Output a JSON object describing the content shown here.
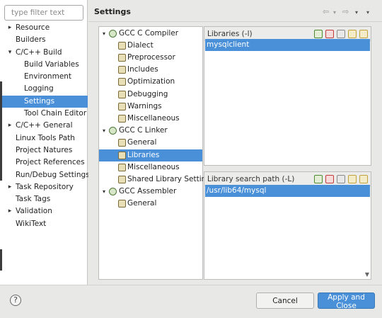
{
  "filter": {
    "placeholder": "type filter text"
  },
  "sidebar": {
    "items": [
      {
        "label": "Resource",
        "expandable": true,
        "indent": 0
      },
      {
        "label": "Builders",
        "expandable": false,
        "indent": 0
      },
      {
        "label": "C/C++ Build",
        "expandable": true,
        "expanded": true,
        "indent": 0
      },
      {
        "label": "Build Variables",
        "expandable": false,
        "indent": 1
      },
      {
        "label": "Environment",
        "expandable": false,
        "indent": 1
      },
      {
        "label": "Logging",
        "expandable": false,
        "indent": 1
      },
      {
        "label": "Settings",
        "expandable": false,
        "indent": 1,
        "selected": true
      },
      {
        "label": "Tool Chain Editor",
        "expandable": false,
        "indent": 1
      },
      {
        "label": "C/C++ General",
        "expandable": true,
        "indent": 0
      },
      {
        "label": "Linux Tools Path",
        "expandable": false,
        "indent": 0
      },
      {
        "label": "Project Natures",
        "expandable": false,
        "indent": 0
      },
      {
        "label": "Project References",
        "expandable": false,
        "indent": 0
      },
      {
        "label": "Run/Debug Settings",
        "expandable": false,
        "indent": 0
      },
      {
        "label": "Task Repository",
        "expandable": true,
        "indent": 0
      },
      {
        "label": "Task Tags",
        "expandable": false,
        "indent": 0
      },
      {
        "label": "Validation",
        "expandable": true,
        "indent": 0
      },
      {
        "label": "WikiText",
        "expandable": false,
        "indent": 0
      }
    ]
  },
  "header": {
    "title": "Settings",
    "back_icon": "back-arrow-icon",
    "forward_icon": "forward-arrow-icon",
    "menu_icon": "view-menu-icon"
  },
  "tool_tree": {
    "items": [
      {
        "label": "GCC C Compiler",
        "type": "tool",
        "expanded": true
      },
      {
        "label": "Dialect",
        "type": "option"
      },
      {
        "label": "Preprocessor",
        "type": "option"
      },
      {
        "label": "Includes",
        "type": "option"
      },
      {
        "label": "Optimization",
        "type": "option"
      },
      {
        "label": "Debugging",
        "type": "option"
      },
      {
        "label": "Warnings",
        "type": "option"
      },
      {
        "label": "Miscellaneous",
        "type": "option"
      },
      {
        "label": "GCC C Linker",
        "type": "tool",
        "expanded": true
      },
      {
        "label": "General",
        "type": "option"
      },
      {
        "label": "Libraries",
        "type": "option",
        "selected": true
      },
      {
        "label": "Miscellaneous",
        "type": "option"
      },
      {
        "label": "Shared Library Settings",
        "type": "option"
      },
      {
        "label": "GCC Assembler",
        "type": "tool",
        "expanded": true
      },
      {
        "label": "General",
        "type": "option"
      }
    ]
  },
  "libraries": {
    "title": "Libraries (-l)",
    "values": [
      "mysqlclient"
    ]
  },
  "search_path": {
    "title": "Library search path (-L)",
    "values": [
      "/usr/lib64/mysql"
    ]
  },
  "footer": {
    "help_glyph": "?",
    "cancel_label": "Cancel",
    "apply_label": "Apply and Close"
  }
}
